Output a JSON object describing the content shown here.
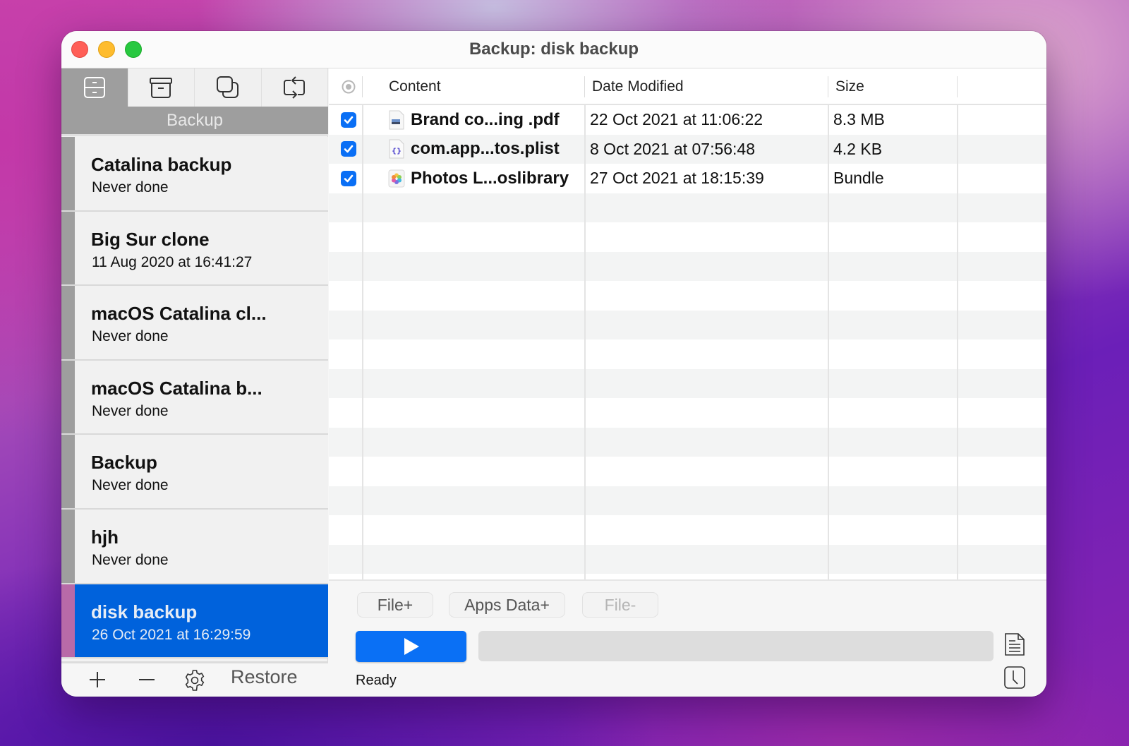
{
  "window": {
    "title": "Backup: disk backup",
    "controls": [
      "close",
      "minimize",
      "zoom"
    ]
  },
  "sidebar": {
    "tabs": [
      {
        "icon": "cabinet-icon",
        "label": "Backup",
        "active": true
      },
      {
        "icon": "archive-box-icon",
        "label": "Archive",
        "active": false
      },
      {
        "icon": "clone-icon",
        "label": "Clone",
        "active": false
      },
      {
        "icon": "sync-icon",
        "label": "Sync",
        "active": false
      }
    ],
    "section_title": "Backup",
    "tasks": [
      {
        "name": "Catalina backup",
        "status": "Never done",
        "selected": false
      },
      {
        "name": "Big Sur clone",
        "status": "11 Aug 2020 at 16:41:27",
        "selected": false
      },
      {
        "name": "macOS Catalina cl...",
        "status": "Never done",
        "selected": false
      },
      {
        "name": "macOS Catalina b...",
        "status": "Never done",
        "selected": false
      },
      {
        "name": "Backup",
        "status": "Never done",
        "selected": false
      },
      {
        "name": "hjh",
        "status": "Never done",
        "selected": false
      },
      {
        "name": "disk backup",
        "status": "26 Oct 2021 at 16:29:59",
        "selected": true
      }
    ],
    "footer": {
      "add_icon": "plus-icon",
      "remove_icon": "minus-icon",
      "settings_icon": "gear-icon",
      "restore_label": "Restore"
    }
  },
  "table": {
    "columns": {
      "select": "",
      "content": "Content",
      "date_modified": "Date Modified",
      "size": "Size"
    },
    "rows": [
      {
        "checked": true,
        "icon": "pdf-file-icon",
        "name": "Brand co...ing .pdf",
        "date": "22 Oct 2021 at 11:06:22",
        "size": "8.3 MB"
      },
      {
        "checked": true,
        "icon": "plist-file-icon",
        "name": "com.app...tos.plist",
        "date": "8 Oct 2021 at 07:56:48",
        "size": "4.2 KB"
      },
      {
        "checked": true,
        "icon": "photos-library-icon",
        "name": "Photos L...oslibrary",
        "date": "27 Oct 2021 at 18:15:39",
        "size": "Bundle"
      }
    ]
  },
  "actions": {
    "file_add": "File+",
    "apps_data_add": "Apps Data+",
    "file_remove": "File-",
    "file_remove_enabled": false
  },
  "run": {
    "progress_percent": 0,
    "status": "Ready"
  },
  "colors": {
    "accent": "#0a70f5",
    "selection": "#0062dc",
    "selected_stripe": "#b86aa8"
  }
}
